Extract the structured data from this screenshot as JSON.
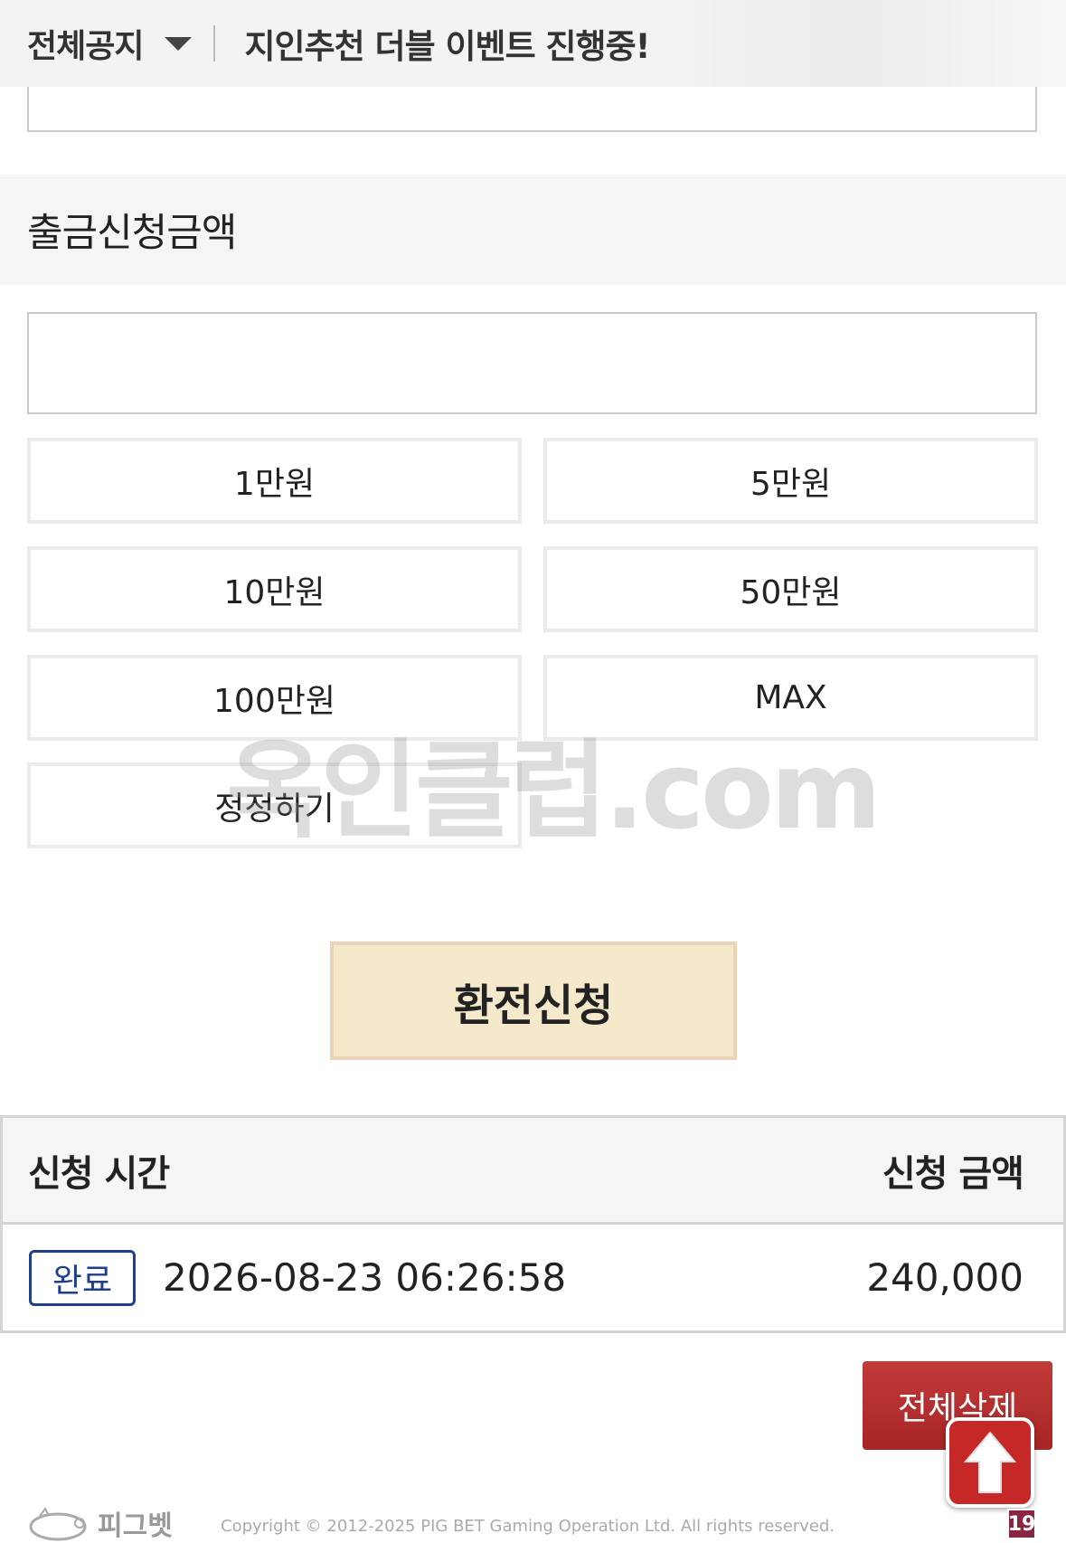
{
  "notice": {
    "label": "전체공지",
    "text": "지인추천 더블 이벤트 진행중!"
  },
  "withdraw": {
    "section_title": "출금신청금액",
    "amount_value": "",
    "quick_buttons": [
      "1만원",
      "5만원",
      "10만원",
      "50만원",
      "100만원",
      "MAX",
      "정정하기"
    ],
    "submit_label": "환전신청"
  },
  "watermark": "옥인클럽.com",
  "history": {
    "headers": {
      "time": "신청 시간",
      "amount": "신청 금액"
    },
    "rows": [
      {
        "status": "완료",
        "time": "2026-08-23 06:26:58",
        "amount": "240,000"
      }
    ]
  },
  "actions": {
    "delete_all": "전체삭제"
  },
  "footer": {
    "logo_text": "피그벳",
    "copyright": "Copyright © 2012-2025 PIG BET Gaming Operation Ltd. All rights reserved.",
    "age_badge": "19"
  },
  "colors": {
    "submit_bg": "#f5e9cb",
    "status_blue": "#1e3f8a",
    "delete_red": "#b02e2e"
  }
}
